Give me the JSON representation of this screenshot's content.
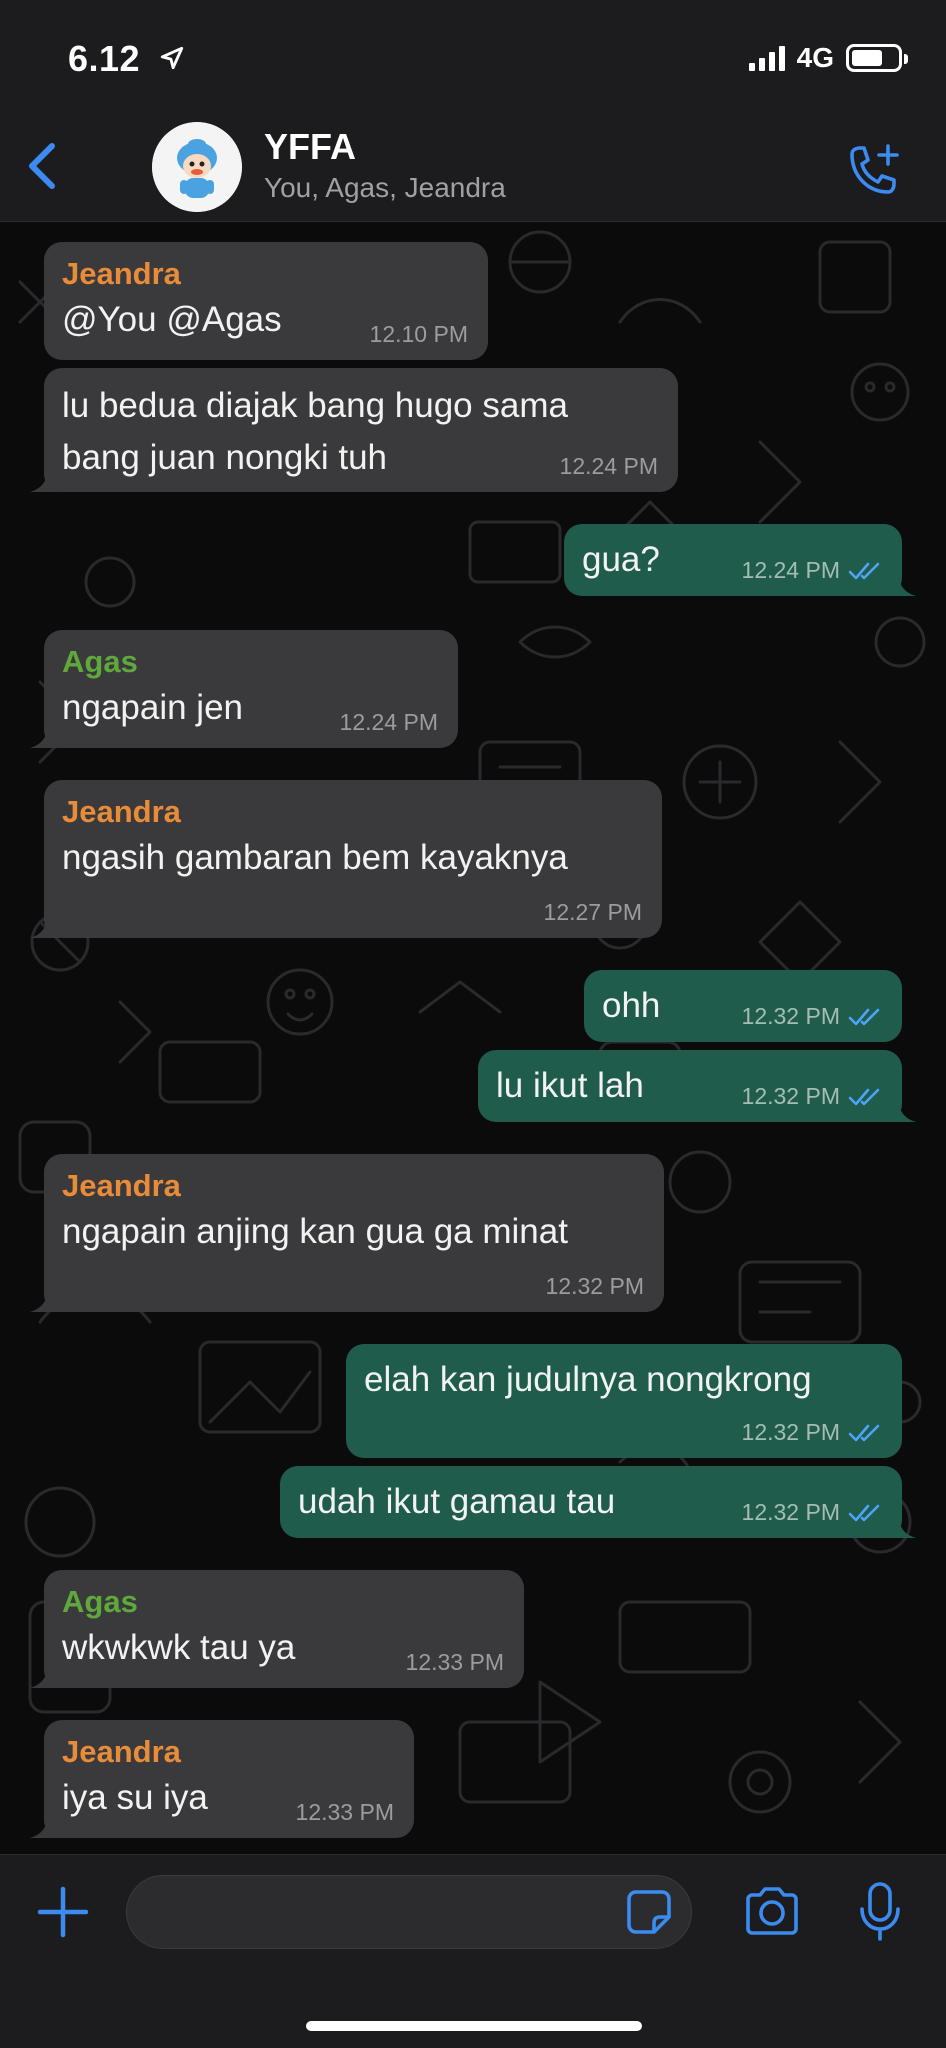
{
  "status_bar": {
    "time": "6.12",
    "network": "4G"
  },
  "header": {
    "title": "YFFA",
    "members": "You, Agas, Jeandra"
  },
  "messages": [
    {
      "sender": "Jeandra",
      "text": "@You @Agas",
      "time": "12.10 PM"
    },
    {
      "text": "lu bedua diajak bang hugo sama",
      "text2": "bang juan nongki tuh",
      "time": "12.24 PM"
    },
    {
      "text": "gua?",
      "time": "12.24 PM"
    },
    {
      "sender": "Agas",
      "text": "ngapain jen",
      "time": "12.24 PM"
    },
    {
      "sender": "Jeandra",
      "text": "ngasih gambaran bem kayaknya",
      "time": "12.27 PM"
    },
    {
      "text": "ohh",
      "time": "12.32 PM"
    },
    {
      "text": "lu ikut lah",
      "time": "12.32 PM"
    },
    {
      "sender": "Jeandra",
      "text": "ngapain anjing kan gua ga minat",
      "time": "12.32 PM"
    },
    {
      "text": "elah kan judulnya nongkrong",
      "time": "12.32 PM"
    },
    {
      "text": "udah ikut gamau tau",
      "time": "12.32 PM"
    },
    {
      "sender": "Agas",
      "text": "wkwkwk tau ya",
      "time": "12.33 PM"
    },
    {
      "sender": "Jeandra",
      "text": "iya su iya",
      "time": "12.33 PM"
    }
  ],
  "icons": {
    "back": "chevron-left-icon",
    "call": "phone-plus-icon",
    "plus": "plus-icon",
    "sticker": "sticker-icon",
    "camera": "camera-icon",
    "mic": "microphone-icon",
    "read": "double-check-icon"
  },
  "colors": {
    "accent": "#3b8bf0",
    "incoming_bubble": "#3a3a3c",
    "outgoing_bubble": "#1f5c4c",
    "sender_jeandra": "#e98c3a",
    "sender_agas": "#5fa83b",
    "read_tick": "#4fa4f5"
  }
}
